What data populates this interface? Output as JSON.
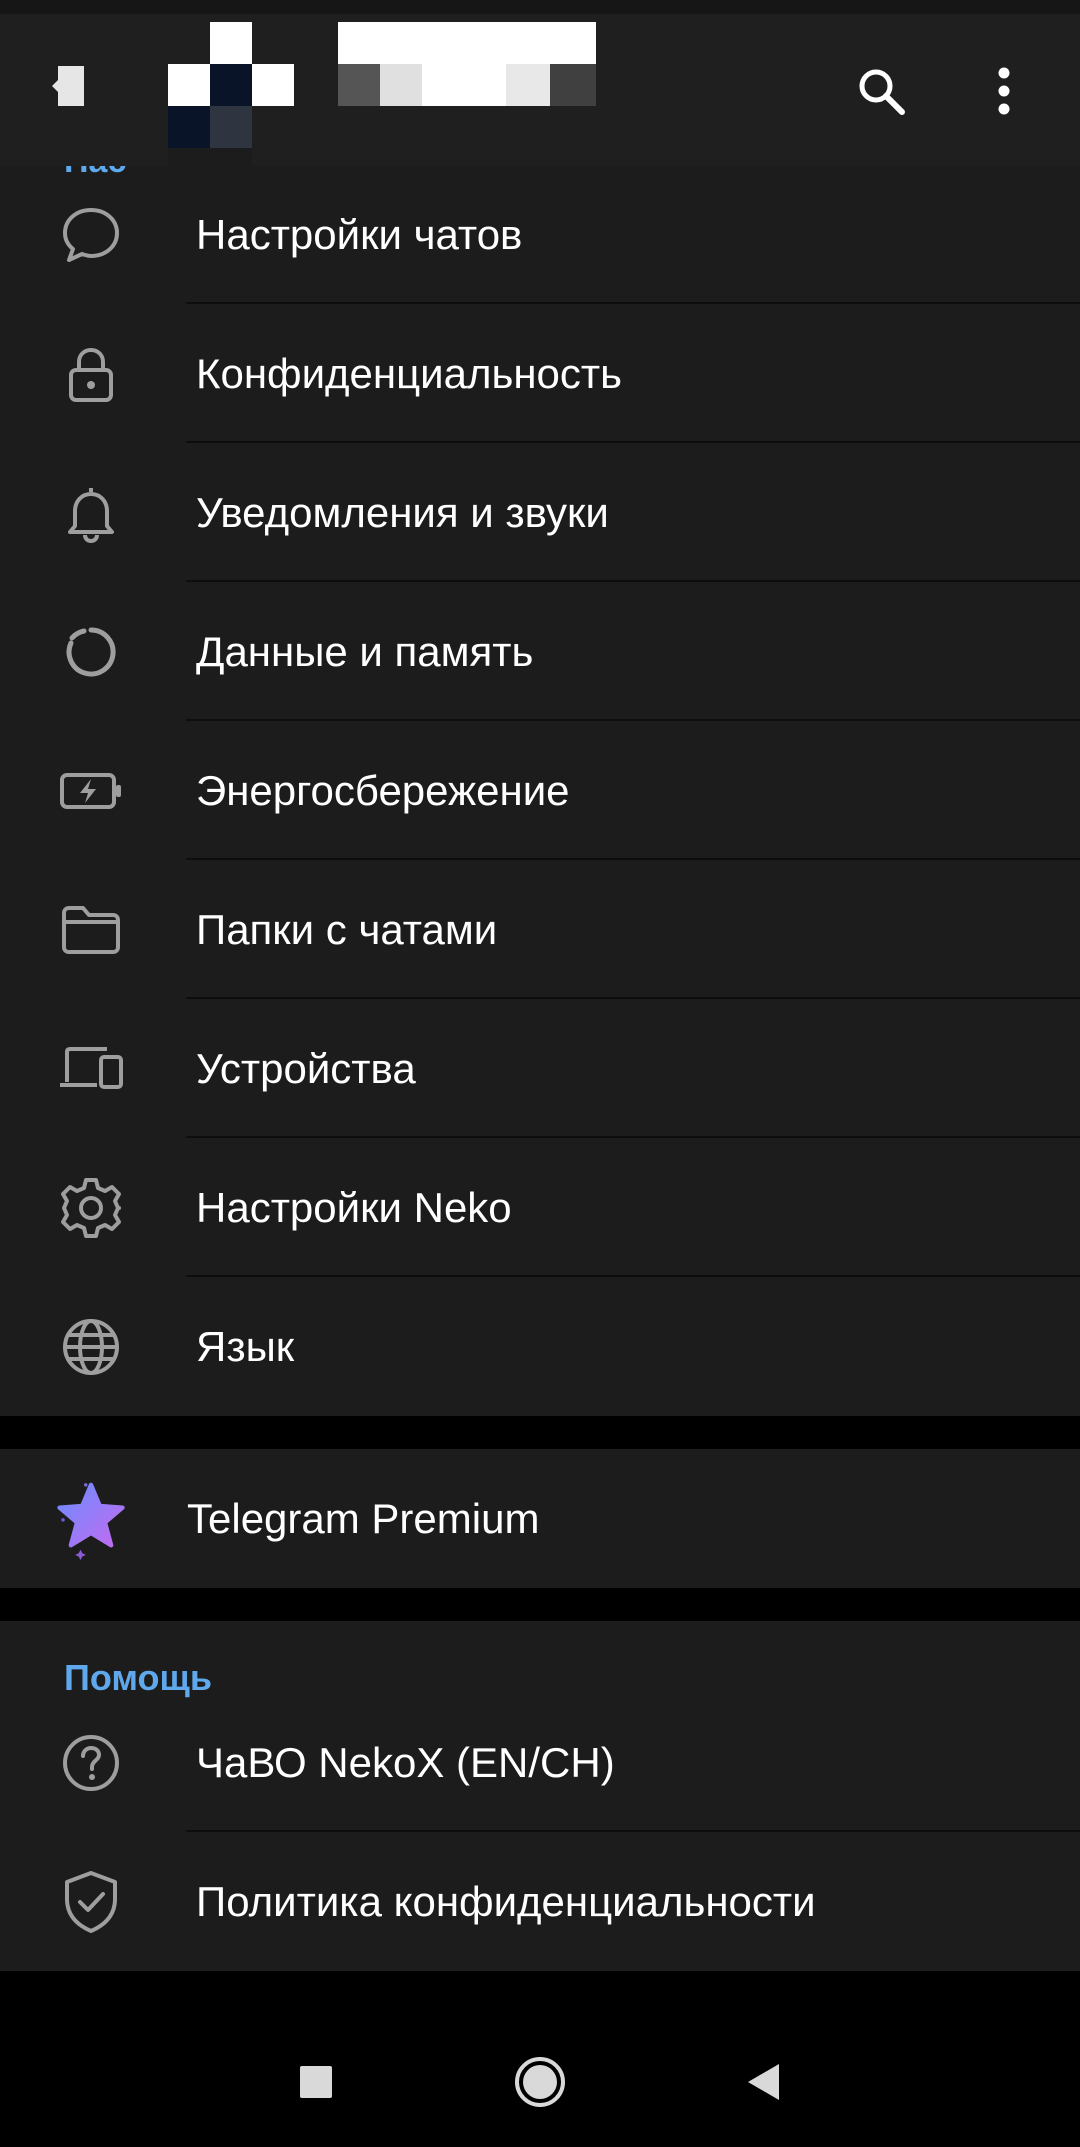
{
  "colors": {
    "accent": "#5fa8ec",
    "surface": "#1c1c1c",
    "appbar": "#1f1f1f",
    "background": "#000000",
    "icon": "#9e9e9e",
    "premium_star_start": "#6b8cff",
    "premium_star_end": "#c36bf0"
  },
  "appbar": {
    "back_icon": "back-arrow-icon",
    "avatar": "pixelated-avatar",
    "name": "",
    "search_icon": "search-icon",
    "more_icon": "more-vertical-icon"
  },
  "peek_header": "Нас",
  "settings": {
    "items": [
      {
        "label": "Настройки чатов",
        "icon": "chat-bubble-icon"
      },
      {
        "label": "Конфиденциальность",
        "icon": "lock-icon"
      },
      {
        "label": "Уведомления и звуки",
        "icon": "bell-icon"
      },
      {
        "label": "Данные и память",
        "icon": "data-circle-icon"
      },
      {
        "label": "Энергосбережение",
        "icon": "battery-bolt-icon"
      },
      {
        "label": "Папки с чатами",
        "icon": "folder-icon"
      },
      {
        "label": "Устройства",
        "icon": "devices-icon"
      },
      {
        "label": "Настройки Neko",
        "icon": "gear-icon"
      },
      {
        "label": "Язык",
        "icon": "globe-icon"
      }
    ]
  },
  "premium": {
    "label": "Telegram Premium",
    "icon": "premium-star-icon"
  },
  "help": {
    "title": "Помощь",
    "items": [
      {
        "label": "ЧаВО NekoX (EN/CH)",
        "icon": "question-icon"
      },
      {
        "label": "Политика конфиденциальности",
        "icon": "shield-check-icon"
      }
    ]
  },
  "navbar": {
    "recents_icon": "recents-square-icon",
    "home_icon": "home-circle-icon",
    "back_icon": "back-triangle-icon"
  }
}
